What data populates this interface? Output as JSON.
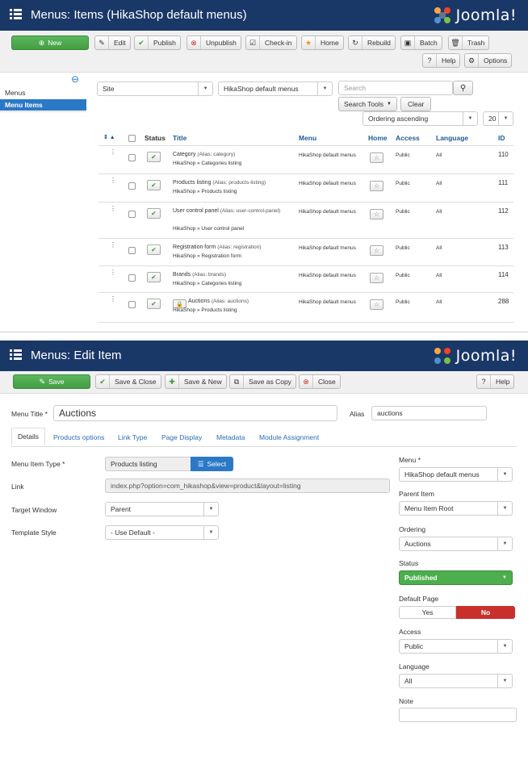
{
  "list_screen": {
    "title": "Menus: Items (HikaShop default menus)",
    "logo_text": "Joomla!",
    "toolbar": {
      "new": "New",
      "edit": "Edit",
      "publish": "Publish",
      "unpublish": "Unpublish",
      "checkin": "Check-in",
      "home": "Home",
      "rebuild": "Rebuild",
      "batch": "Batch",
      "trash": "Trash",
      "help": "Help",
      "options": "Options"
    },
    "sidebar": {
      "items": [
        {
          "label": "Menus",
          "active": false
        },
        {
          "label": "Menu Items",
          "active": true
        }
      ]
    },
    "filters": {
      "client": "Site",
      "menu": "HikaShop default menus",
      "search_placeholder": "Search",
      "search_tools": "Search Tools",
      "clear": "Clear",
      "ordering": "Ordering ascending",
      "limit": "20"
    },
    "columns": {
      "status": "Status",
      "title": "Title",
      "menu": "Menu",
      "home": "Home",
      "access": "Access",
      "language": "Language",
      "id": "ID"
    },
    "rows": [
      {
        "title": "Category",
        "alias": "(Alias: category)",
        "type": "HikaShop » Categories listing",
        "menu": "HikaShop default menus",
        "access": "Public",
        "language": "All",
        "id": "110"
      },
      {
        "title": "Products listing",
        "alias": "(Alias: products-listing)",
        "type": "HikaShop » Products listing",
        "menu": "HikaShop default menus",
        "access": "Public",
        "language": "All",
        "id": "111"
      },
      {
        "title": "User control panel",
        "alias": "(Alias: user-control-panel)",
        "type": "HikaShop » User control panel",
        "menu": "HikaShop default menus",
        "access": "Public",
        "language": "All",
        "id": "112"
      },
      {
        "title": "Registration form",
        "alias": "(Alias: registration)",
        "type": "HikaShop » Registration form",
        "menu": "HikaShop default menus",
        "access": "Public",
        "language": "All",
        "id": "113"
      },
      {
        "title": "Brands",
        "alias": "(Alias: brands)",
        "type": "HikaShop » Categories listing",
        "menu": "HikaShop default menus",
        "access": "Public",
        "language": "All",
        "id": "114"
      },
      {
        "title": "Auctions",
        "alias": "(Alias: auctions)",
        "type": "HikaShop » Products listing",
        "menu": "HikaShop default menus",
        "access": "Public",
        "language": "All",
        "id": "288"
      }
    ]
  },
  "edit_screen": {
    "title": "Menus: Edit Item",
    "logo_text": "Joomla!",
    "toolbar": {
      "save": "Save",
      "save_close": "Save & Close",
      "save_new": "Save & New",
      "save_copy": "Save as Copy",
      "close": "Close",
      "help": "Help"
    },
    "menu_title_label": "Menu Title *",
    "menu_title_value": "Auctions",
    "alias_label": "Alias",
    "alias_value": "auctions",
    "tabs": [
      "Details",
      "Products options",
      "Link Type",
      "Page Display",
      "Metadata",
      "Module Assignment"
    ],
    "fields": {
      "menu_item_type_label": "Menu Item Type *",
      "menu_item_type_value": "Products listing",
      "select_button": "Select",
      "link_label": "Link",
      "link_value": "index.php?option=com_hikashop&view=product&layout=listing",
      "target_window_label": "Target Window",
      "target_window_value": "Parent",
      "template_style_label": "Template Style",
      "template_style_value": "- Use Default -"
    },
    "right": {
      "menu_label": "Menu *",
      "menu_value": "HikaShop default menus",
      "parent_label": "Parent Item",
      "parent_value": "Menu Item Root",
      "ordering_label": "Ordering",
      "ordering_value": "Auctions",
      "status_label": "Status",
      "status_value": "Published",
      "default_page_label": "Default Page",
      "yes": "Yes",
      "no": "No",
      "access_label": "Access",
      "access_value": "Public",
      "language_label": "Language",
      "language_value": "All",
      "note_label": "Note",
      "note_value": ""
    },
    "colors": {
      "header": "#1a3867",
      "green": "#4cae4c",
      "red": "#c9302c",
      "blue": "#2a78c6"
    }
  }
}
